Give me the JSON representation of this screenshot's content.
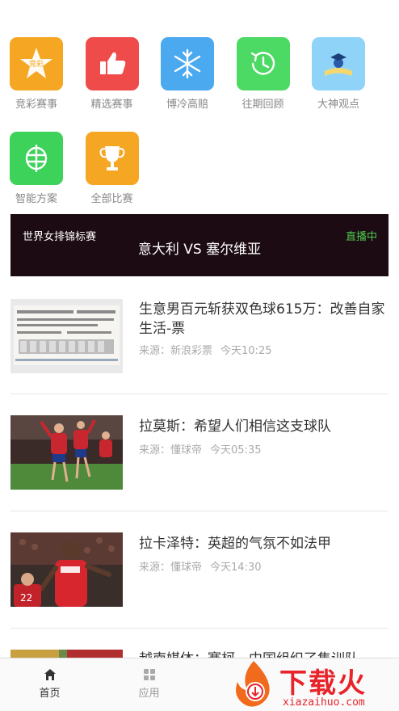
{
  "categories": [
    {
      "label": "竞彩赛事",
      "icon": "jingcai-star-icon",
      "color": "#f5a623",
      "badge": "竞彩"
    },
    {
      "label": "精选赛事",
      "icon": "thumbs-up-icon",
      "color": "#f04b4b"
    },
    {
      "label": "博冷高赔",
      "icon": "snowflake-icon",
      "color": "#4ba9f0"
    },
    {
      "label": "往期回顾",
      "icon": "history-clock-icon",
      "color": "#4cd964"
    },
    {
      "label": "大神观点",
      "icon": "graduate-icon",
      "color": "#6cc3f5"
    },
    {
      "label": "智能方案",
      "icon": "smart-plan-icon",
      "color": "#3dd25a"
    },
    {
      "label": "全部比赛",
      "icon": "trophy-icon",
      "color": "#f5a623"
    }
  ],
  "live": {
    "league": "世界女排锦标赛",
    "match": "意大利 VS 塞尔维亚",
    "status": "直播中",
    "status_color": "#4ec94e"
  },
  "news": [
    {
      "title": "生意男百元斩获双色球615万：改善自家生活-票",
      "source": "来源：新浪彩票",
      "time": "今天10:25",
      "thumb": "lottery-ticket-image"
    },
    {
      "title": "拉莫斯：希望人们相信这支球队",
      "source": "来源：懂球帝",
      "time": "今天05:35",
      "thumb": "spain-team-image"
    },
    {
      "title": "拉卡泽特：英超的气氛不如法甲",
      "source": "来源：懂球帝",
      "time": "今天14:30",
      "thumb": "arsenal-player-image"
    },
    {
      "title": "越南媒体：赛柯，中国组织了集训队",
      "thumb": "football-pitch-image"
    }
  ],
  "tabs": [
    {
      "label": "首页",
      "icon": "home-icon",
      "active": true
    },
    {
      "label": "应用",
      "icon": "grid-apps-icon",
      "active": false
    }
  ],
  "watermark": {
    "brand": "下载火",
    "url": "xiazaihuo.com"
  }
}
